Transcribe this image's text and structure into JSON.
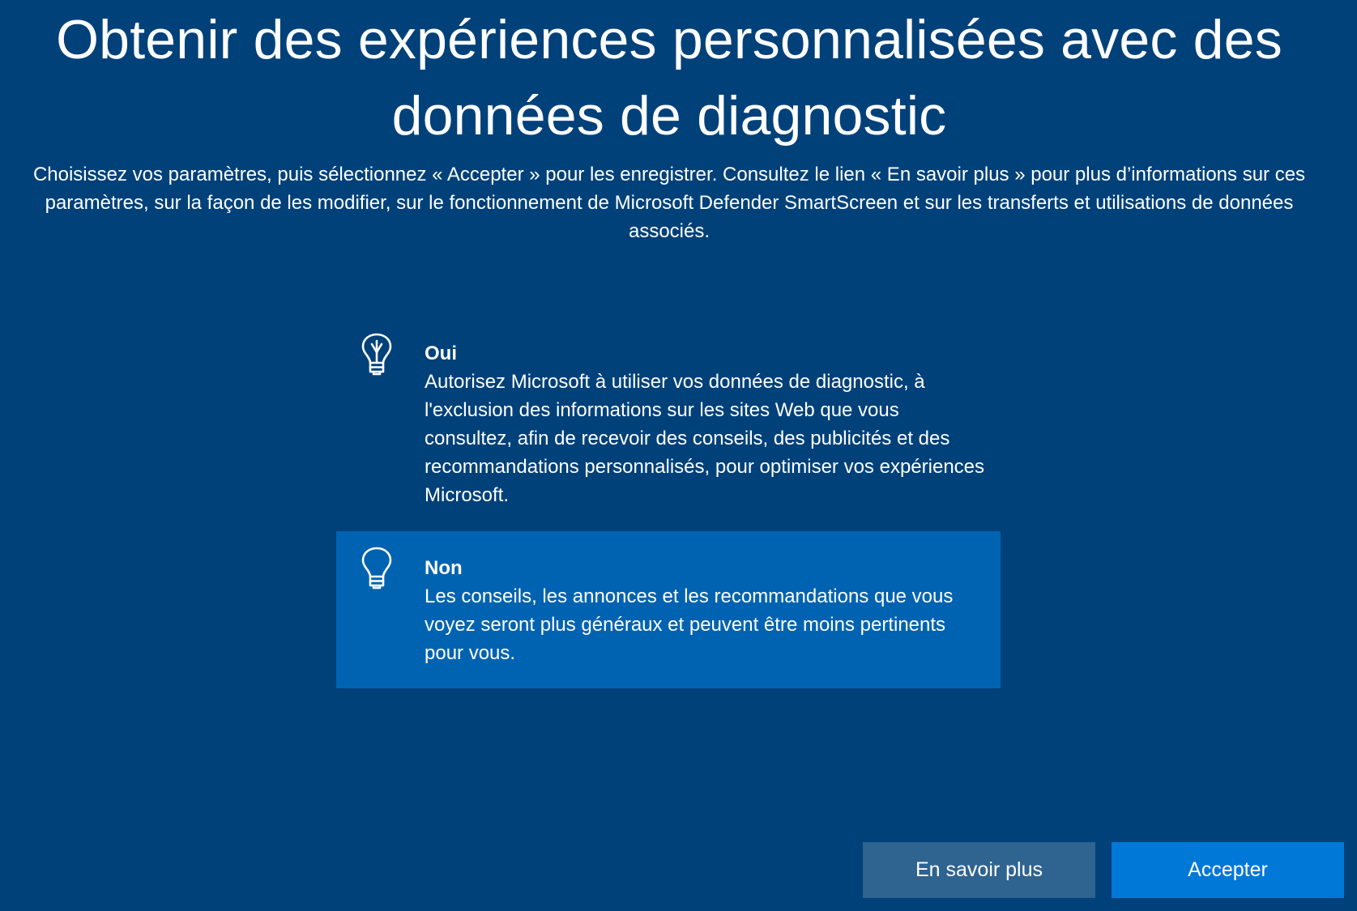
{
  "page": {
    "title_line1": "Obtenir des expériences personnalisées avec des",
    "title_line2": "données de diagnostic",
    "subtitle": "Choisissez vos paramètres, puis sélectionnez « Accepter » pour les enregistrer. Consultez le lien « En savoir plus » pour plus d’informations sur ces paramètres, sur la façon de les modifier, sur le fonctionnement de Microsoft Defender SmartScreen et sur les transferts et utilisations de données associés."
  },
  "options": [
    {
      "title": "Oui",
      "description": "Autorisez Microsoft à utiliser vos données de diagnostic, à l'exclusion des informations sur les sites Web que vous consultez, afin de recevoir des conseils, des publicités et des recommandations personnalisés, pour optimiser vos expériences Microsoft.",
      "icon": "lightbulb-on-icon",
      "selected": false
    },
    {
      "title": "Non",
      "description": "Les conseils, les annonces et les recommandations que vous voyez seront plus généraux et peuvent être moins pertinents pour vous.",
      "icon": "lightbulb-off-icon",
      "selected": true
    }
  ],
  "buttons": {
    "learn_more": "En savoir plus",
    "accept": "Accepter"
  },
  "colors": {
    "background": "#00417A",
    "selected_option": "#0063B1",
    "secondary_button": "#2F6390",
    "primary_button": "#0078D7",
    "text": "#FFFFFF"
  }
}
